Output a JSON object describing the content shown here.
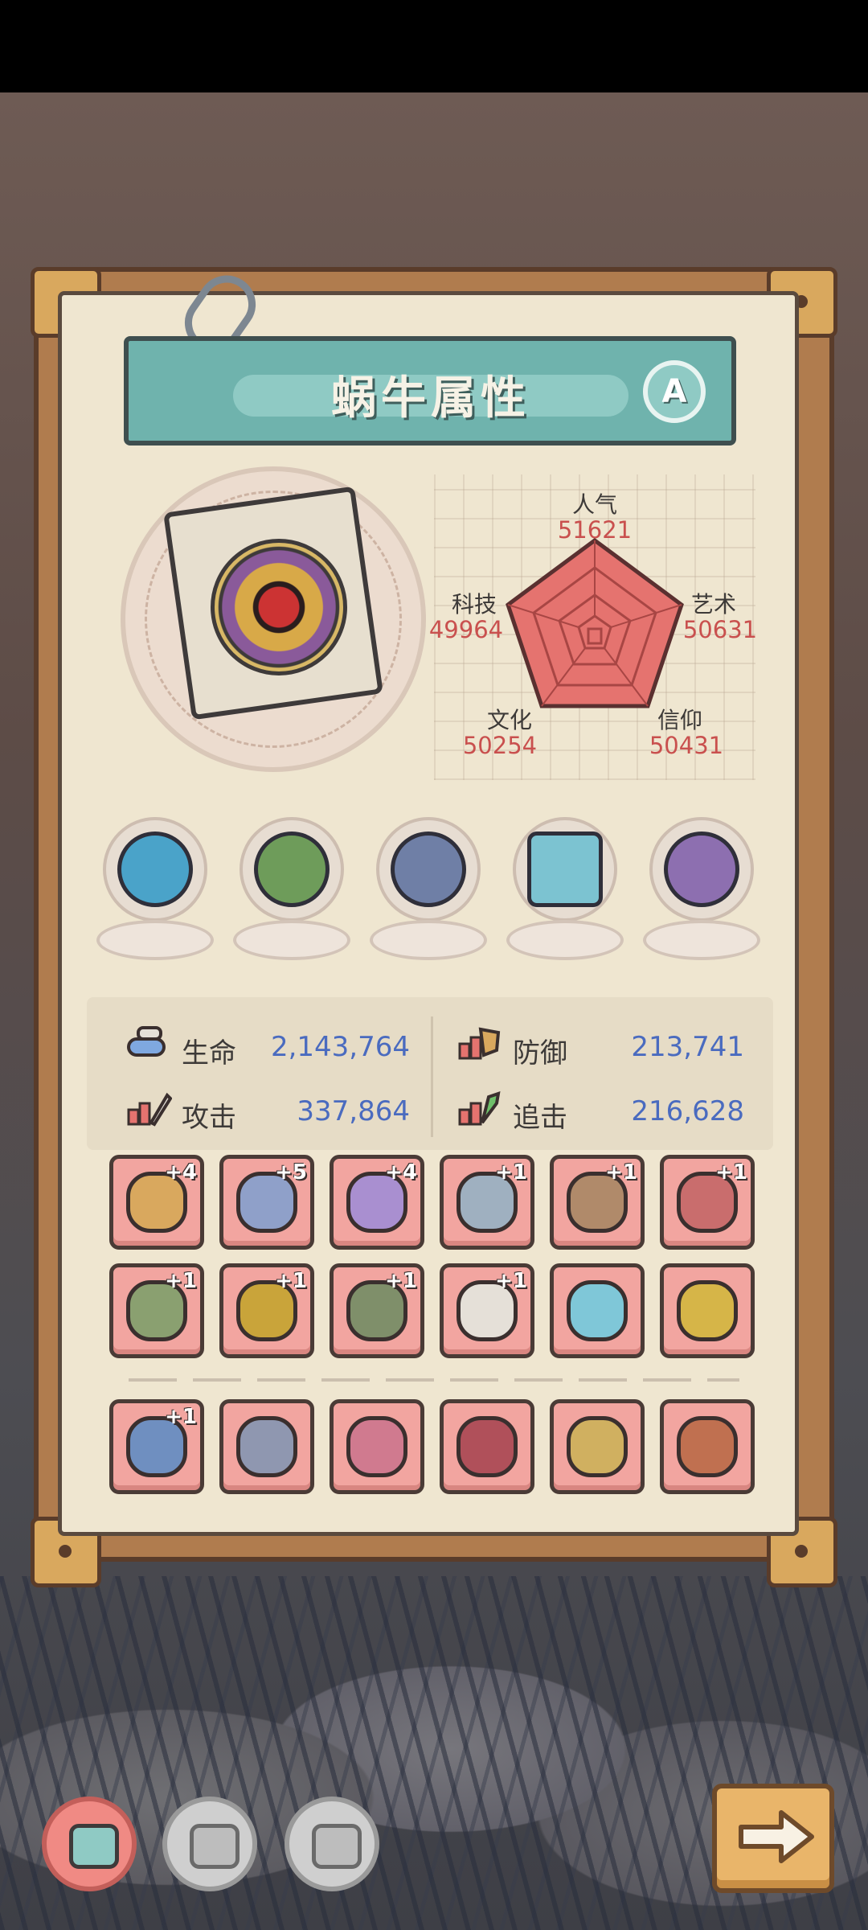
{
  "title": "蜗牛属性",
  "rank": "A",
  "radar": {
    "stats": [
      {
        "name": "人气",
        "value": "51621"
      },
      {
        "name": "艺术",
        "value": "50631"
      },
      {
        "name": "信仰",
        "value": "50431"
      },
      {
        "name": "文化",
        "value": "50254"
      },
      {
        "name": "科技",
        "value": "49964"
      }
    ]
  },
  "relics": [
    {
      "icon": "blue-serpent-icon",
      "color": "#4aa3c9"
    },
    {
      "icon": "tree-bowl-icon",
      "color": "#6e9c5a"
    },
    {
      "icon": "compass-icon",
      "color": "#6f7fa6"
    },
    {
      "icon": "eye-tablet-icon",
      "color": "#7cc3d1"
    },
    {
      "icon": "gem-plate-icon",
      "color": "#8d6fb0"
    }
  ],
  "attributes": [
    {
      "label": "生命",
      "value": "2,143,764",
      "icon": "health-pill-icon"
    },
    {
      "label": "防御",
      "value": "213,741",
      "icon": "defense-icon"
    },
    {
      "label": "攻击",
      "value": "337,864",
      "icon": "attack-icon"
    },
    {
      "label": "追击",
      "value": "216,628",
      "icon": "pursuit-icon"
    }
  ],
  "equipment": [
    {
      "level": "+4",
      "icon": "ring-icon",
      "color": "#d9a85e"
    },
    {
      "level": "+5",
      "icon": "bow-icon",
      "color": "#8fa0c9"
    },
    {
      "level": "+4",
      "icon": "chain-icon",
      "color": "#a98fd0"
    },
    {
      "level": "+1",
      "icon": "dagger-icon",
      "color": "#9fb0c0"
    },
    {
      "level": "+1",
      "icon": "sword-icon",
      "color": "#b08a6a"
    },
    {
      "level": "+1",
      "icon": "scepter-icon",
      "color": "#c96d6d"
    },
    {
      "level": "+1",
      "icon": "hammer-icon",
      "color": "#8aa070"
    },
    {
      "level": "+1",
      "icon": "crossbow-icon",
      "color": "#c9a43a"
    },
    {
      "level": "+1",
      "icon": "bracer-icon",
      "color": "#7f8f6a"
    },
    {
      "level": "+1",
      "icon": "helmet-icon",
      "color": "#e5e0d8"
    },
    {
      "level": "",
      "icon": "blade-icon",
      "color": "#7fc7d8"
    },
    {
      "level": "",
      "icon": "amulet-icon",
      "color": "#d6b548"
    },
    {
      "level": "+1",
      "icon": "gauntlet-icon",
      "color": "#6f8fc0"
    },
    {
      "level": "",
      "icon": "axe-icon",
      "color": "#8f97b0"
    },
    {
      "level": "",
      "icon": "flower-shield-icon",
      "color": "#d07a8f"
    },
    {
      "level": "",
      "icon": "armor-icon",
      "color": "#b0505a"
    },
    {
      "level": "",
      "icon": "chest-icon",
      "color": "#d0b060"
    },
    {
      "level": "",
      "icon": "spear-icon",
      "color": "#c07050"
    }
  ],
  "nav": [
    {
      "icon": "snail-face-icon",
      "active": true
    },
    {
      "icon": "robot-face-icon",
      "active": false
    },
    {
      "icon": "brain-icon",
      "active": false
    }
  ],
  "next_icon": "arrow-right-icon"
}
